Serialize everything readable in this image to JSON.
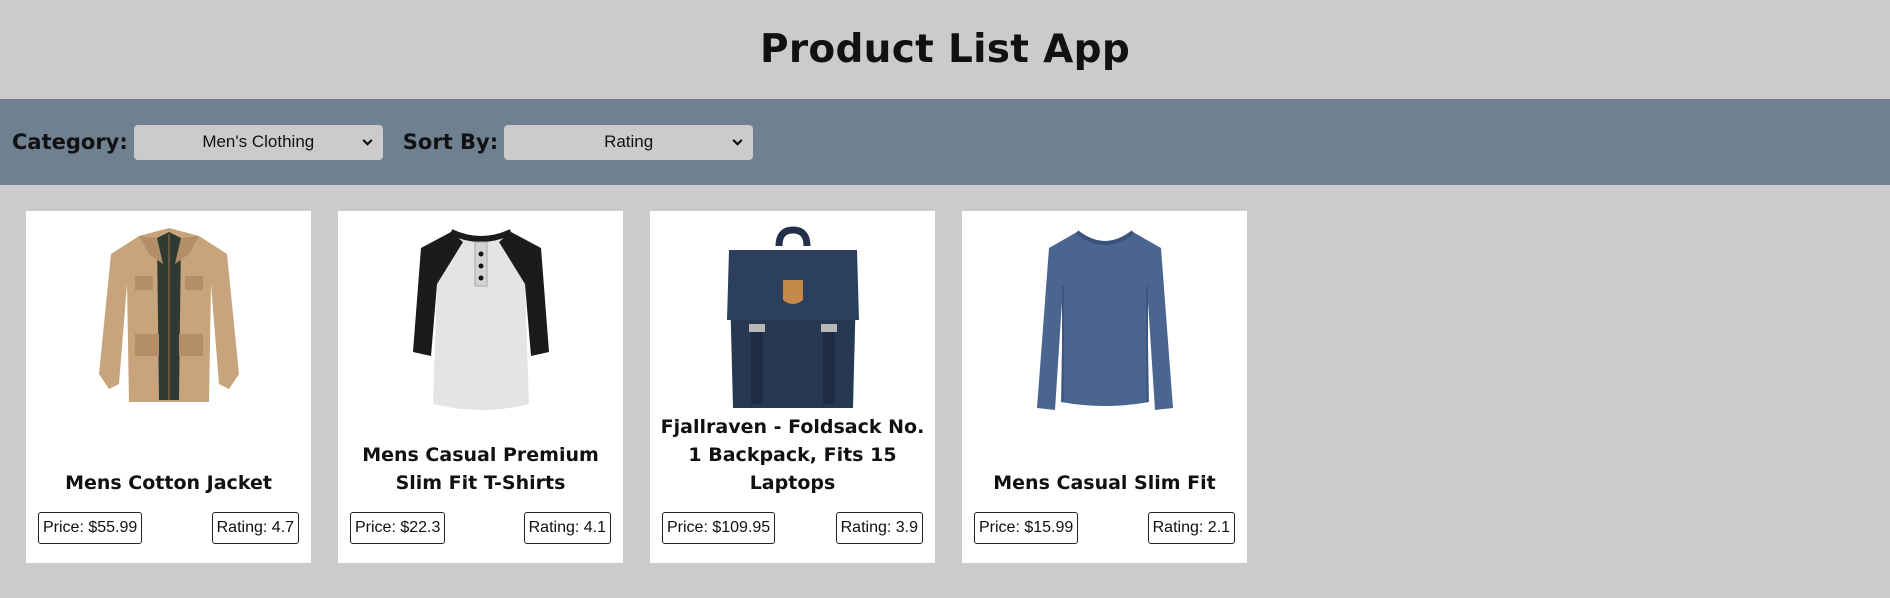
{
  "app": {
    "title": "Product List App"
  },
  "filters": {
    "category_label": "Category:",
    "category_value": "Men's Clothing",
    "sort_label": "Sort By:",
    "sort_value": "Rating"
  },
  "products": [
    {
      "title": "Mens Cotton Jacket",
      "price": "Price: $55.99",
      "rating": "Rating: 4.7",
      "image": "jacket"
    },
    {
      "title": "Mens Casual Premium Slim Fit T-Shirts",
      "price": "Price: $22.3",
      "rating": "Rating: 4.1",
      "image": "raglan-tshirt"
    },
    {
      "title": "Fjallraven - Foldsack No. 1 Backpack, Fits 15 Laptops",
      "price": "Price: $109.95",
      "rating": "Rating: 3.9",
      "image": "backpack"
    },
    {
      "title": "Mens Casual Slim Fit",
      "price": "Price: $15.99",
      "rating": "Rating: 2.1",
      "image": "long-sleeve-shirt"
    }
  ],
  "colors": {
    "page_bg": "#cbcbcb",
    "toolbar_bg": "#6f8090",
    "card_bg": "#ffffff"
  }
}
